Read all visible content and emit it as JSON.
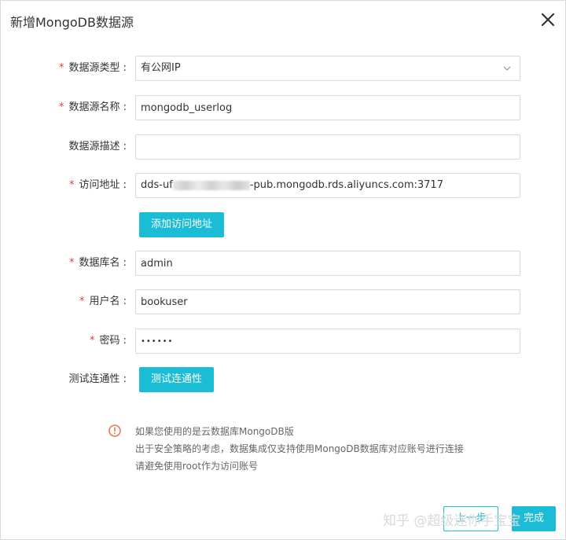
{
  "dialog": {
    "title": "新增MongoDB数据源",
    "close_icon": "close-icon"
  },
  "form": {
    "type": {
      "required_mark": "*",
      "label": "数据源类型 :",
      "value": "有公网IP",
      "icon": "chevron-down-icon"
    },
    "name": {
      "required_mark": "*",
      "label": "数据源名称 :",
      "value": "mongodb_userlog"
    },
    "desc": {
      "label": "数据源描述 :",
      "value": ""
    },
    "address": {
      "required_mark": "*",
      "label": "访问地址 :",
      "value_prefix": "dds-uf",
      "value_suffix": "-pub.mongodb.rds.aliyuncs.com:3717"
    },
    "add_address_button": "添加访问地址",
    "database": {
      "required_mark": "*",
      "label": "数据库名 :",
      "value": "admin"
    },
    "username": {
      "required_mark": "*",
      "label": "用户名 :",
      "value": "bookuser"
    },
    "password": {
      "required_mark": "*",
      "label": "密码 :",
      "value": "••••••"
    },
    "test": {
      "label": "测试连通性 :",
      "button": "测试连通性"
    }
  },
  "notice": {
    "icon": "info-icon",
    "color": "#e8764a",
    "lines": [
      "如果您使用的是云数据库MongoDB版",
      "出于安全策略的考虑，数据集成仅支持使用MongoDB数据库对应账号进行连接",
      "请避免使用root作为访问账号"
    ]
  },
  "footer": {
    "cancel_label": "上一步",
    "ok_label": "完成"
  },
  "watermark": "知乎 @超级迷你手宝宝",
  "colors": {
    "accent": "#1bbcd5",
    "required": "#e4393c"
  }
}
